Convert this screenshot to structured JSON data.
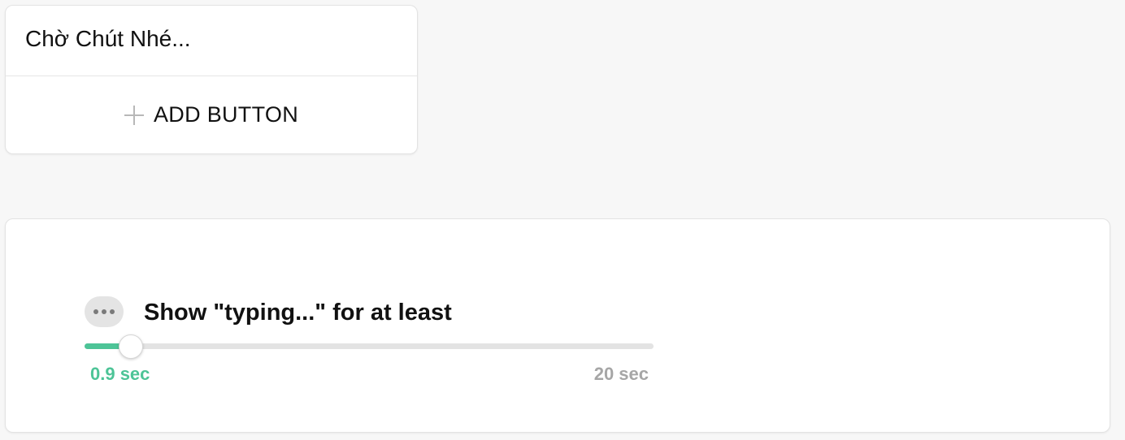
{
  "text_card": {
    "message": "Chờ Chút Nhé...",
    "add_button_label": "ADD BUTTON"
  },
  "typing_card": {
    "title": "Show \"typing...\" for at least",
    "value_label": "0.9 sec",
    "max_label": "20 sec",
    "slider": {
      "min": 0,
      "max": 20,
      "value": 0.9
    }
  },
  "colors": {
    "accent": "#4dc497",
    "muted": "#a6a6a6",
    "background": "#f7f7f7"
  },
  "icons": {
    "add": "plus-icon",
    "typing": "typing-dots-icon"
  }
}
